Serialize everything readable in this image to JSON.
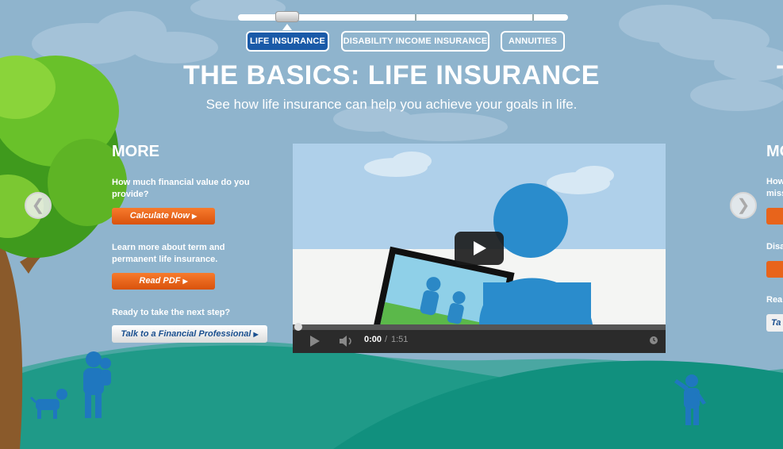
{
  "tabs": [
    {
      "label": "LIFE INSURANCE",
      "active": true
    },
    {
      "label": "DISABILITY INCOME INSURANCE",
      "active": false
    },
    {
      "label": "ANNUITIES",
      "active": false
    }
  ],
  "header": {
    "title": "THE BASICS: LIFE INSURANCE",
    "subtitle": "See how life insurance can help you achieve your goals in life."
  },
  "more": {
    "heading": "MORE",
    "items": [
      {
        "text": "How much financial value do you provide?",
        "button": "Calculate Now"
      },
      {
        "text": "Learn more about term and permanent life insurance.",
        "button": "Read PDF"
      }
    ],
    "next_step": {
      "text": "Ready to take the next step?",
      "button": "Talk to a Financial Professional"
    }
  },
  "video": {
    "current_time": "0:00",
    "duration": "1:51"
  },
  "right_peek": {
    "title_fragment": "T",
    "heading_fragment": "MO",
    "line1": "How",
    "line2": "miss",
    "line3": "Disa",
    "line4": "Rea",
    "button_fragment": "Ta"
  },
  "colors": {
    "sky": "#8fb4cd",
    "active_tab": "#1a5aa8",
    "orange_button": "#e8641b",
    "ground": "#1f9a88",
    "figure_blue": "#1f77bf"
  }
}
